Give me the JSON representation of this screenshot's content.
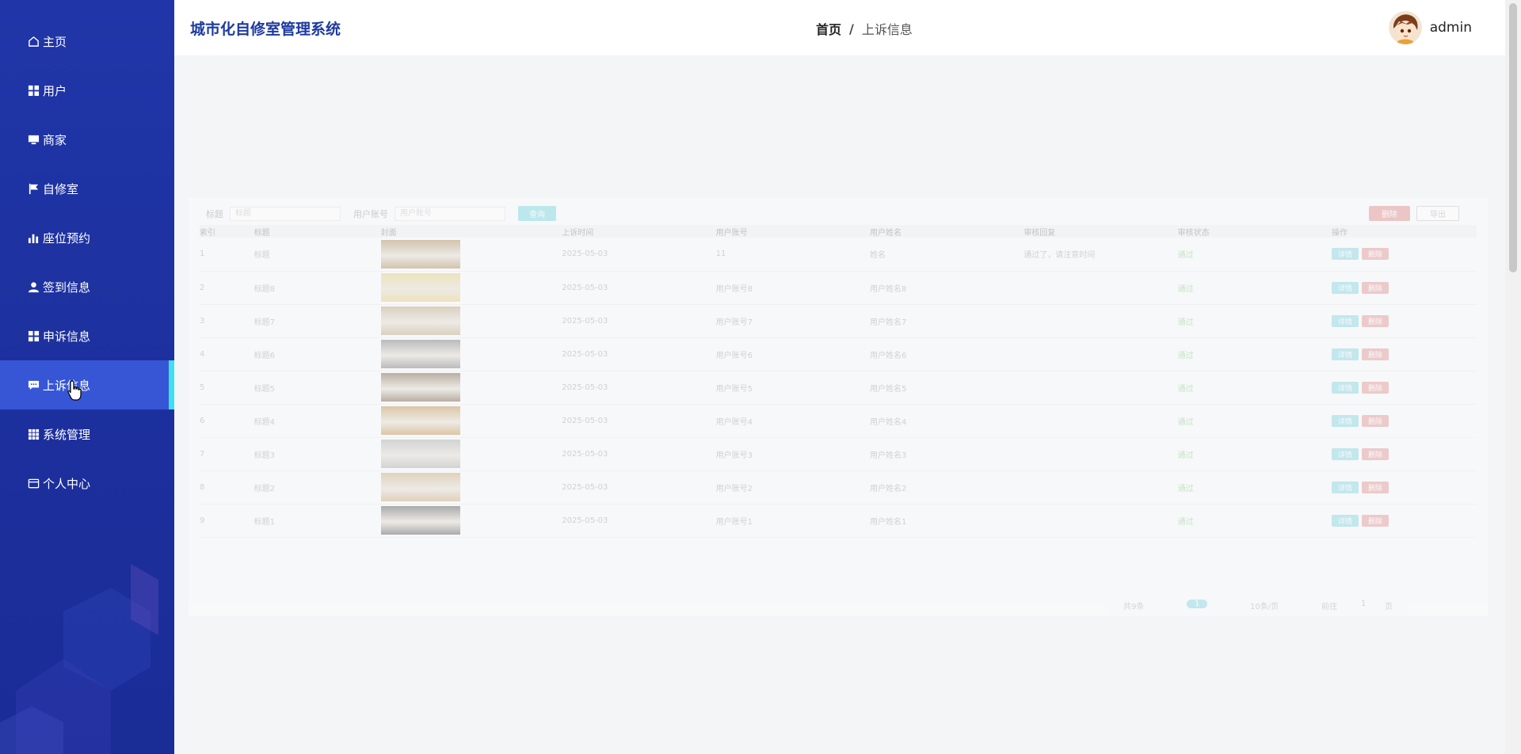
{
  "app": {
    "title": "城市化自修室管理系统"
  },
  "sidebar": {
    "items": [
      {
        "label": "主页",
        "icon": "home-icon",
        "active": false
      },
      {
        "label": "用户",
        "icon": "grid-icon",
        "active": false
      },
      {
        "label": "商家",
        "icon": "monitor-icon",
        "active": false
      },
      {
        "label": "自修室",
        "icon": "flag-icon",
        "active": false
      },
      {
        "label": "座位预约",
        "icon": "bar-chart-icon",
        "active": false
      },
      {
        "label": "签到信息",
        "icon": "user-icon",
        "active": false
      },
      {
        "label": "申诉信息",
        "icon": "grid-icon",
        "active": false
      },
      {
        "label": "上诉信息",
        "icon": "chat-icon",
        "active": true
      },
      {
        "label": "系统管理",
        "icon": "apps-icon",
        "active": false
      },
      {
        "label": "个人中心",
        "icon": "card-icon",
        "active": false
      }
    ]
  },
  "header": {
    "breadcrumb": {
      "home": "首页",
      "separator": "/",
      "current": "上诉信息"
    },
    "user": {
      "name": "admin"
    }
  },
  "colors": {
    "sidebar_bg": "#1e33a3",
    "sidebar_active": "#3656d6",
    "active_indicator": "#3de0f2",
    "title": "#1e3aa0"
  },
  "content": {
    "filter": {
      "label1": "标题",
      "placeholder1": "标题",
      "label2": "用户账号",
      "placeholder2": "用户账号",
      "search": "查询"
    },
    "buttons": {
      "delete": "删除",
      "export": "导出"
    },
    "columns": [
      "索引",
      "标题",
      "封面",
      "上诉时间",
      "用户账号",
      "用户姓名",
      "审核回复",
      "审核状态",
      "操作"
    ],
    "rows": [
      {
        "idx": "1",
        "title": "标题",
        "time": "2025-05-03",
        "account": "11",
        "name": "姓名",
        "reply": "通过了，请注意时间",
        "status": "通过",
        "color": "#b89a70"
      },
      {
        "idx": "2",
        "title": "标题8",
        "time": "2025-05-03",
        "account": "用户账号8",
        "name": "用户姓名8",
        "reply": "",
        "status": "通过",
        "color": "#e8d58a"
      },
      {
        "idx": "3",
        "title": "标题7",
        "time": "2025-05-03",
        "account": "用户账号7",
        "name": "用户姓名7",
        "reply": "",
        "status": "通过",
        "color": "#c7b393"
      },
      {
        "idx": "4",
        "title": "标题6",
        "time": "2025-05-03",
        "account": "用户账号6",
        "name": "用户姓名6",
        "reply": "",
        "status": "通过",
        "color": "#8c8c8c"
      },
      {
        "idx": "5",
        "title": "标题5",
        "time": "2025-05-03",
        "account": "用户账号5",
        "name": "用户姓名5",
        "reply": "",
        "status": "通过",
        "color": "#8a7560"
      },
      {
        "idx": "6",
        "title": "标题4",
        "time": "2025-05-03",
        "account": "用户账号4",
        "name": "用户姓名4",
        "reply": "",
        "status": "通过",
        "color": "#c9a066"
      },
      {
        "idx": "7",
        "title": "标题3",
        "time": "2025-05-03",
        "account": "用户账号3",
        "name": "用户姓名3",
        "reply": "",
        "status": "通过",
        "color": "#b8b8b8"
      },
      {
        "idx": "8",
        "title": "标题2",
        "time": "2025-05-03",
        "account": "用户账号2",
        "name": "用户姓名2",
        "reply": "",
        "status": "通过",
        "color": "#d0b68c"
      },
      {
        "idx": "9",
        "title": "标题1",
        "time": "2025-05-03",
        "account": "用户账号1",
        "name": "用户姓名1",
        "reply": "",
        "status": "通过",
        "color": "#6e6e6e"
      }
    ],
    "row_actions": {
      "edit": "详情",
      "delete": "删除"
    },
    "pager": {
      "total": "共9条",
      "current": "1",
      "size": "10条/页",
      "goto": "前往",
      "page": "1",
      "unit": "页"
    }
  }
}
